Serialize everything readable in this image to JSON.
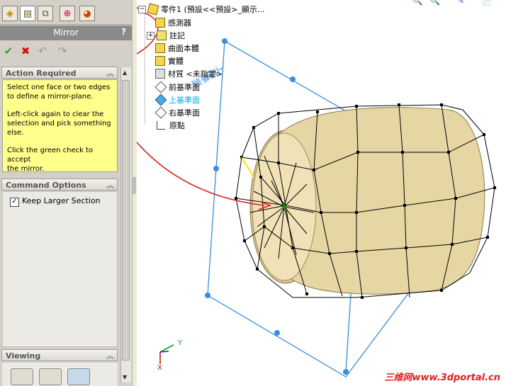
{
  "panel": {
    "title": "Mirror",
    "help": "?",
    "tabs": [
      "feature-manager-tab",
      "property-manager-tab",
      "configuration-manager-tab",
      "dimxpert-tab",
      "display-manager-tab"
    ],
    "action_required": {
      "header": "Action Required",
      "line1": "Select one face or two edges",
      "line2": "to define a mirror-plane.",
      "line3": "Left-click again to clear the",
      "line4": "selection and pick something",
      "line5": "else.",
      "line6": "Click the green check to accept",
      "line7": "the mirror."
    },
    "command_options": {
      "header": "Command Options",
      "checkbox_label": "Keep Larger Section",
      "checked": true
    },
    "viewing": {
      "header": "Viewing"
    },
    "collapse_glyph": "︽"
  },
  "tree": {
    "root": "零件1 (預設<<預設>_顯示...",
    "items": [
      "感測器",
      "註記",
      "曲面本體",
      "實體",
      "材質 <未指定>",
      "前基準面",
      "上基準面",
      "右基準面",
      "原點"
    ],
    "selected_color": "#00aadd"
  },
  "viewport": {
    "plane_label": "上基準面",
    "axis_y": "Y",
    "axis_x": "X",
    "watermark": "三维网www.3dportal.cn",
    "toolbar_glyphs": "🔍🔍 ✎ 📄"
  },
  "colors": {
    "body_fill": "#e6d6a4",
    "plane_blue": "#3a8ed8",
    "annotation_red": "#e02020"
  }
}
